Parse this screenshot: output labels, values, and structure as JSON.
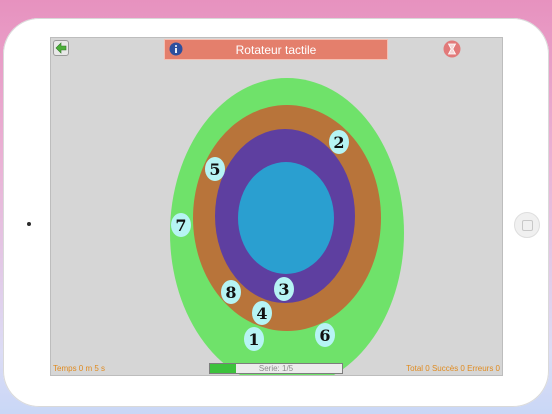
{
  "game": {
    "title": "Rotateur tactile",
    "buttons": {
      "back_icon": "back-arrow-icon",
      "info_icon": "info-icon",
      "timer_icon": "hourglass-icon"
    },
    "rings": [
      {
        "name": "outer-ring",
        "color": "#6fe26a"
      },
      {
        "name": "ring-2",
        "color": "#b8743a"
      },
      {
        "name": "ring-3",
        "color": "#5e3fa0"
      },
      {
        "name": "center-disc",
        "color": "#2a9fd0"
      }
    ],
    "tokens": [
      "2",
      "5",
      "7",
      "3",
      "8",
      "4",
      "1",
      "6"
    ],
    "token_color": "#b6f4f4",
    "status": {
      "time": "Temps 0 m 5 s",
      "totals": "Total 0 Succès 0 Erreurs 0"
    },
    "series": {
      "label": "Serie: 1/5",
      "progress": 0.2,
      "fill_color": "#3dc23d"
    }
  }
}
